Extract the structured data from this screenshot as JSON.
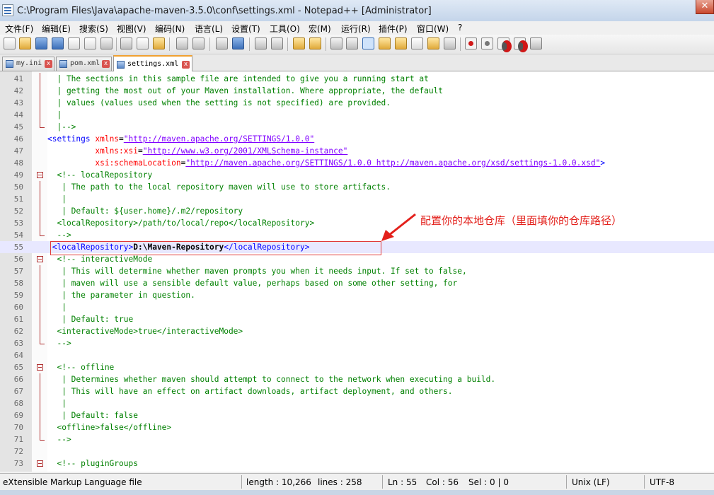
{
  "window": {
    "title": "C:\\Program Files\\Java\\apache-maven-3.5.0\\conf\\settings.xml - Notepad++ [Administrator]",
    "close_glyph": "✕"
  },
  "menu": [
    "文件(F)",
    "编辑(E)",
    "搜索(S)",
    "视图(V)",
    "编码(N)",
    "语言(L)",
    "设置(T)",
    "工具(O)",
    "宏(M)",
    "运行(R)",
    "插件(P)",
    "窗口(W)",
    "?"
  ],
  "toolbar_icons": [
    "new-file-icon",
    "open-file-icon",
    "save-icon",
    "save-all-icon",
    "close-icon",
    "close-all-icon",
    "print-icon",
    "cut-icon",
    "copy-icon",
    "paste-icon",
    "undo-icon",
    "redo-icon",
    "find-icon",
    "replace-icon",
    "zoom-in-icon",
    "zoom-out-icon",
    "sync-v-icon",
    "sync-h-icon",
    "word-wrap-icon",
    "show-all-chars-icon",
    "indent-guide-icon",
    "doc-map-icon",
    "function-list-icon",
    "folder-icon",
    "monitor-icon",
    "record-macro-icon",
    "stop-record-icon",
    "play-macro-icon",
    "run-macro-multiple-icon",
    "save-macro-icon"
  ],
  "tabs": [
    {
      "label": "my.ini",
      "close": "x",
      "active": false
    },
    {
      "label": "pom.xml",
      "close": "x",
      "active": false
    },
    {
      "label": "settings.xml",
      "close": "x",
      "active": true
    }
  ],
  "editor": {
    "lines": [
      {
        "n": "41",
        "text": "  | The sections in this sample file are intended to give you a running start at"
      },
      {
        "n": "42",
        "text": "  | getting the most out of your Maven installation. Where appropriate, the default"
      },
      {
        "n": "43",
        "text": "  | values (values used when the setting is not specified) are provided."
      },
      {
        "n": "44",
        "text": "  |"
      },
      {
        "n": "45",
        "text": "  |-->"
      },
      {
        "n": "46",
        "tag_open": "<settings",
        "attr": " xmlns",
        "eq": "=",
        "val": "\"http://maven.apache.org/SETTINGS/1.0.0\""
      },
      {
        "n": "47",
        "pad": "          ",
        "attr": "xmlns:xsi",
        "eq": "=",
        "val": "\"http://www.w3.org/2001/XMLSchema-instance\""
      },
      {
        "n": "48",
        "pad": "          ",
        "attr": "xsi:schemaLocation",
        "eq": "=",
        "val": "\"http://maven.apache.org/SETTINGS/1.0.0 http://maven.apache.org/xsd/settings-1.0.0.xsd\"",
        "tag_close": ">"
      },
      {
        "n": "49",
        "text": "  <!-- localRepository"
      },
      {
        "n": "50",
        "text": "   | The path to the local repository maven will use to store artifacts."
      },
      {
        "n": "51",
        "text": "   |"
      },
      {
        "n": "52",
        "text": "   | Default: ${user.home}/.m2/repository"
      },
      {
        "n": "53",
        "text": "  <localRepository>/path/to/local/repo</localRepository>"
      },
      {
        "n": "54",
        "text": "  -->"
      },
      {
        "n": "55",
        "open": " <localRepository>",
        "value": "D:\\Maven-Repository",
        "close": "</localRepository>"
      },
      {
        "n": "56",
        "text": "  <!-- interactiveMode"
      },
      {
        "n": "57",
        "text": "   | This will determine whether maven prompts you when it needs input. If set to false,"
      },
      {
        "n": "58",
        "text": "   | maven will use a sensible default value, perhaps based on some other setting, for"
      },
      {
        "n": "59",
        "text": "   | the parameter in question."
      },
      {
        "n": "60",
        "text": "   |"
      },
      {
        "n": "61",
        "text": "   | Default: true"
      },
      {
        "n": "62",
        "text": "  <interactiveMode>true</interactiveMode>"
      },
      {
        "n": "63",
        "text": "  -->"
      },
      {
        "n": "64",
        "text": ""
      },
      {
        "n": "65",
        "text": "  <!-- offline"
      },
      {
        "n": "66",
        "text": "   | Determines whether maven should attempt to connect to the network when executing a build."
      },
      {
        "n": "67",
        "text": "   | This will have an effect on artifact downloads, artifact deployment, and others."
      },
      {
        "n": "68",
        "text": "   |"
      },
      {
        "n": "69",
        "text": "   | Default: false"
      },
      {
        "n": "70",
        "text": "  <offline>false</offline>"
      },
      {
        "n": "71",
        "text": "  -->"
      },
      {
        "n": "72",
        "text": ""
      },
      {
        "n": "73",
        "text": "  <!-- pluginGroups"
      }
    ],
    "current_line": "55"
  },
  "annotation": {
    "text": "配置你的本地仓库（里面填你的仓库路径）",
    "color": "#e3201b"
  },
  "status": {
    "file_type": "eXtensible Markup Language file",
    "length": "length : 10,266",
    "lines": "lines : 258",
    "ln": "Ln : 55",
    "col": "Col : 56",
    "sel": "Sel : 0 | 0",
    "eol": "Unix (LF)",
    "encoding": "UTF-8"
  },
  "colors": {
    "comment": "#008000",
    "tag": "#0000ff",
    "attribute": "#ff0000",
    "attribute_value": "#8000ff",
    "highlight_box": "#e03a3a"
  }
}
